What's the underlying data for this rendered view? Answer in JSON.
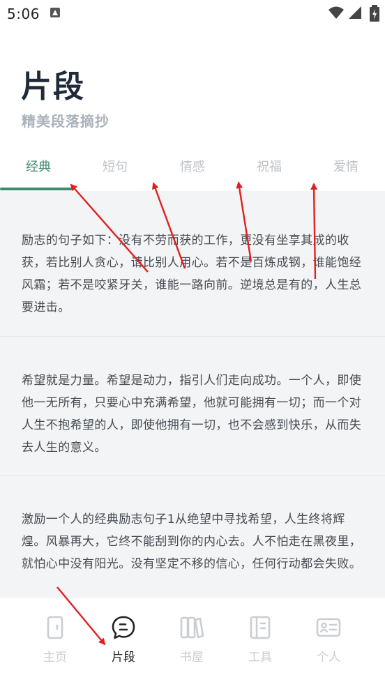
{
  "status_bar": {
    "time": "5:06"
  },
  "header": {
    "title": "片段",
    "subtitle": "精美段落摘抄"
  },
  "tabs": [
    {
      "label": "经典",
      "active": true
    },
    {
      "label": "短句",
      "active": false
    },
    {
      "label": "情感",
      "active": false
    },
    {
      "label": "祝福",
      "active": false
    },
    {
      "label": "爱情",
      "active": false
    }
  ],
  "cards": [
    {
      "text": "励志的句子如下：没有不劳而获的工作，更没有坐享其成的收获，若比别人贪心，请比别人用心。若不是百炼成钢，谁能饱经风霜；若不是咬紧牙关，谁能一路向前。逆境总是有的，人生总要进击。"
    },
    {
      "text": "希望就是力量。希望是动力，指引人们走向成功。一个人，即使他一无所有，只要心中充满希望，他就可能拥有一切；而一个对人生不抱希望的人，即使他拥有一切，也不会感到快乐，从而失去人生的意义。"
    },
    {
      "text": "激励一个人的经典励志句子1从绝望中寻找希望，人生终将辉煌。风暴再大，它终不能刮到你的内心去。人不怕走在黑夜里，就怕心中没有阳光。没有坚定不移的信心，任何行动都会失败。"
    }
  ],
  "bottom_nav": [
    {
      "label": "主页",
      "icon": "door-icon",
      "active": false
    },
    {
      "label": "片段",
      "icon": "chat-bubble-icon",
      "active": true
    },
    {
      "label": "书屋",
      "icon": "books-icon",
      "active": false
    },
    {
      "label": "工具",
      "icon": "notebook-icon",
      "active": false
    },
    {
      "label": "个人",
      "icon": "id-card-icon",
      "active": false
    }
  ],
  "colors": {
    "accent": "#3f8a6e",
    "annotation_arrow": "#e02020",
    "content_bg": "#f3f4f5",
    "inactive": "#c9ced3"
  }
}
